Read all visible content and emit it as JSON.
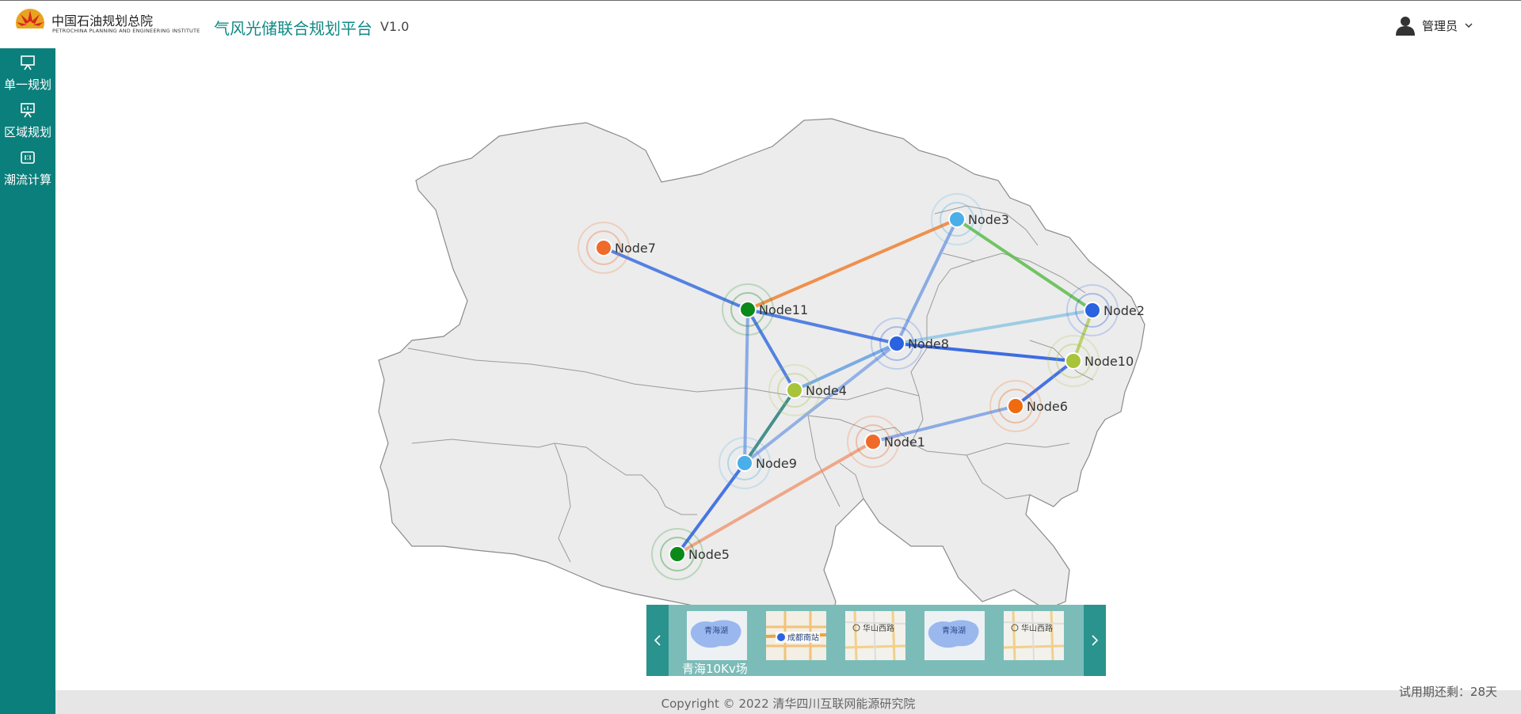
{
  "header": {
    "org_cn": "中国石油规划总院",
    "org_en": "PETROCHINA PLANNING AND ENGINEERING INSTITUTE",
    "app_title": "气风光储联合规划平台",
    "version": "V1.0",
    "user_name": "管理员"
  },
  "sidebar": {
    "items": [
      {
        "label": "单一规划",
        "icon": "presentation-board-icon"
      },
      {
        "label": "区域规划",
        "icon": "presentation-chart-icon"
      },
      {
        "label": "潮流计算",
        "icon": "calculator-icon"
      }
    ]
  },
  "map": {
    "nodes": [
      {
        "name": "Node1",
        "color": "#f06a2a"
      },
      {
        "name": "Node2",
        "color": "#2a62e0"
      },
      {
        "name": "Node3",
        "color": "#4aaee8"
      },
      {
        "name": "Node4",
        "color": "#a8c43a"
      },
      {
        "name": "Node5",
        "color": "#0b8a1a"
      },
      {
        "name": "Node6",
        "color": "#f06a10"
      },
      {
        "name": "Node7",
        "color": "#f06a2a"
      },
      {
        "name": "Node8",
        "color": "#2a62e0"
      },
      {
        "name": "Node9",
        "color": "#4aaee8"
      },
      {
        "name": "Node10",
        "color": "#a8c43a"
      },
      {
        "name": "Node11",
        "color": "#0b8a1a"
      }
    ]
  },
  "carousel": {
    "caption": "青海10Kv场",
    "thumbs": [
      {
        "label": "青海湖"
      },
      {
        "label": "成都南站"
      },
      {
        "label": "华山西路"
      },
      {
        "label": "青海湖"
      },
      {
        "label": "华山西路"
      }
    ]
  },
  "footer": {
    "copyright": "Copyright © 2022 清华四川互联网能源研究院",
    "trial": "试用期还剩：28天"
  }
}
